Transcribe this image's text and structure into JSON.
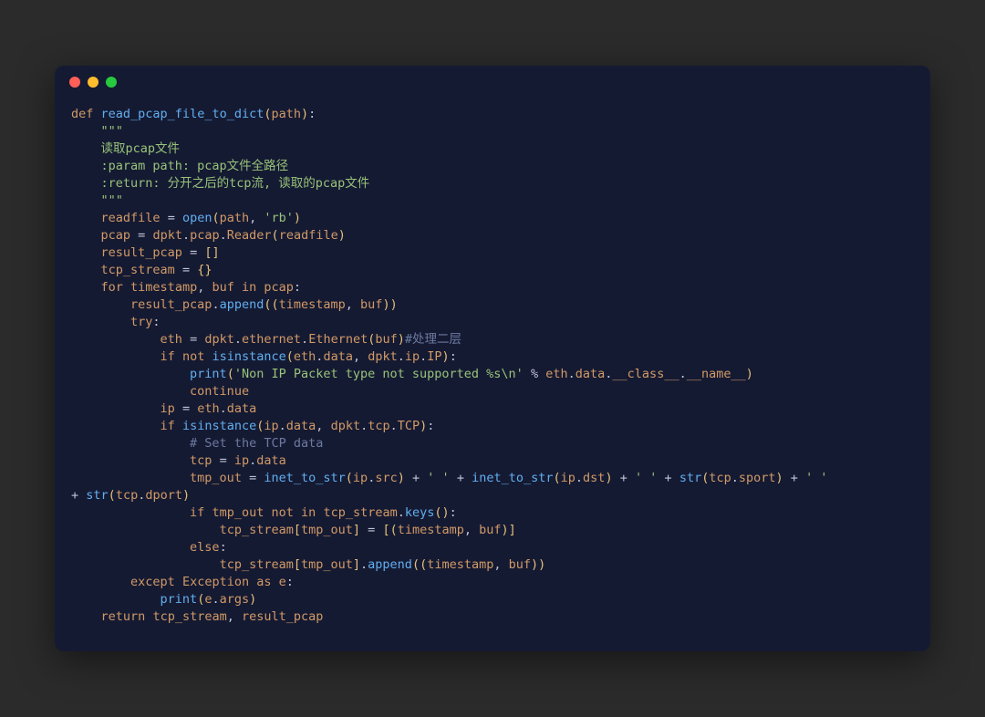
{
  "colors": {
    "background_body": "#2b2b2b",
    "background_window": "#151a33",
    "dot_red": "#ff5f56",
    "dot_yellow": "#ffbd2e",
    "dot_green": "#27c93f",
    "keyword": "#d19a66",
    "function": "#61afef",
    "string": "#98c379",
    "punctuation": "#e5c07b",
    "comment": "#6b7a9e",
    "default": "#c0c5d8"
  },
  "code_lines": [
    "def read_pcap_file_to_dict(path):",
    "    \"\"\"",
    "    读取pcap文件",
    "    :param path: pcap文件全路径",
    "    :return: 分开之后的tcp流, 读取的pcap文件",
    "    \"\"\"",
    "    readfile = open(path, 'rb')",
    "    pcap = dpkt.pcap.Reader(readfile)",
    "    result_pcap = []",
    "    tcp_stream = {}",
    "    for timestamp, buf in pcap:",
    "        result_pcap.append((timestamp, buf))",
    "        try:",
    "            eth = dpkt.ethernet.Ethernet(buf)#处理二层",
    "            if not isinstance(eth.data, dpkt.ip.IP):",
    "                print('Non IP Packet type not supported %s\\n' % eth.data.__class__.__name__)",
    "                continue",
    "            ip = eth.data",
    "            if isinstance(ip.data, dpkt.tcp.TCP):",
    "                # Set the TCP data",
    "                tcp = ip.data",
    "                tmp_out = inet_to_str(ip.src) + ' ' + inet_to_str(ip.dst) + ' ' + str(tcp.sport) + ' ' + str(tcp.dport)",
    "                if tmp_out not in tcp_stream.keys():",
    "                    tcp_stream[tmp_out] = [(timestamp, buf)]",
    "                else:",
    "                    tcp_stream[tmp_out].append((timestamp, buf))",
    "        except Exception as e:",
    "            print(e.args)",
    "    return tcp_stream, result_pcap"
  ]
}
